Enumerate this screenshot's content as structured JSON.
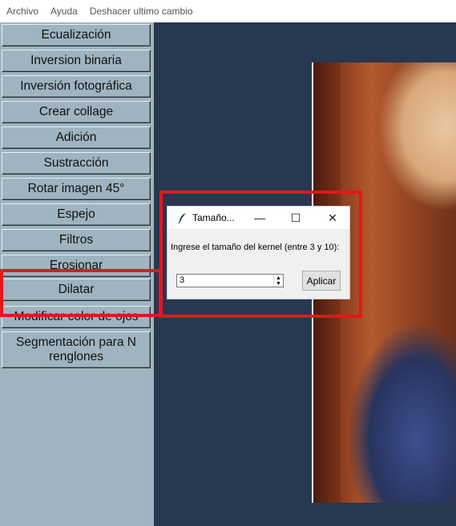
{
  "menubar": {
    "items": [
      "Archivo",
      "Ayuda",
      "Deshacer ultimo cambio"
    ]
  },
  "sidebar": {
    "buttons": [
      "Ecualización",
      "Inversion binaria",
      "Inversión fotográfica",
      "Crear collage",
      "Adición",
      "Sustracción",
      "Rotar imagen 45°",
      "Espejo",
      "Filtros",
      "Erosionar",
      "Dilatar",
      "Modificar color de ojos",
      "Segmentación para N renglones"
    ]
  },
  "dialog": {
    "title": "Tamaño...",
    "icon": "feather-icon",
    "minimize_glyph": "—",
    "maximize_glyph": "☐",
    "close_glyph": "✕",
    "label": "Ingrese el tamaño del kernel (entre 3 y 10):",
    "spin_value": "3",
    "spin_up": "▲",
    "spin_down": "▼",
    "apply_label": "Aplicar"
  },
  "colors": {
    "sidebar_bg": "#9fb4c0",
    "canvas_bg": "#273850",
    "highlight": "#e8141e"
  }
}
